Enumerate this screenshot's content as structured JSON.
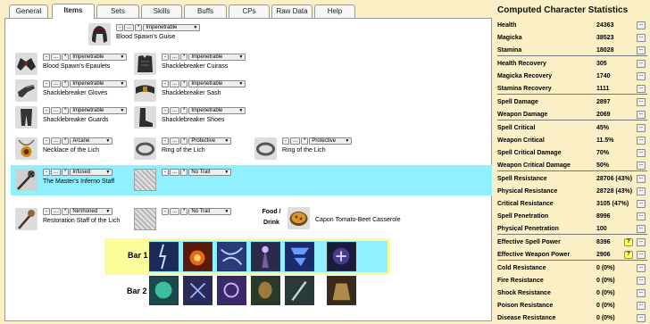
{
  "tabs": [
    "General",
    "Items",
    "Sets",
    "Skills",
    "Buffs",
    "CPs",
    "Raw Data",
    "Help"
  ],
  "active_tab": "Items",
  "ctrl": {
    "minus": "-",
    "dots": "...",
    "star": "*"
  },
  "items": {
    "head": {
      "name": "Blood Spawn's Guise",
      "trait": "Impenetrable"
    },
    "shoulders": {
      "name": "Blood Spawn's Epaulets",
      "trait": "Impenetrable"
    },
    "chest": {
      "name": "Shacklebreaker Cuirass",
      "trait": "Impenetrable"
    },
    "hands": {
      "name": "Shacklebreaker Gloves",
      "trait": "Impenetrable"
    },
    "waist": {
      "name": "Shacklebreaker Sash",
      "trait": "Impenetrable"
    },
    "legs": {
      "name": "Shacklebreaker Guards",
      "trait": "Impenetrable"
    },
    "feet": {
      "name": "Shacklebreaker Shoes",
      "trait": "Impenetrable"
    },
    "neck": {
      "name": "Necklace of the Lich",
      "trait": "Arcane"
    },
    "ring1": {
      "name": "Ring of the Lich",
      "trait": "Protective"
    },
    "ring2": {
      "name": "Ring of the Lich",
      "trait": "Protective"
    },
    "main1": {
      "name": "The Master's Inferno Staff",
      "trait": "Infused"
    },
    "off1": {
      "name": "",
      "trait": "No Trait"
    },
    "main2": {
      "name": "Restoration Staff of the Lich",
      "trait": "Nirnhoned"
    },
    "off2": {
      "name": "",
      "trait": "No Trait"
    }
  },
  "food": {
    "label_1": "Food /",
    "label_2": "Drink",
    "name": "Capon Tomato-Beet Casserole"
  },
  "bars": {
    "bar1": "Bar 1",
    "bar2": "Bar 2"
  },
  "stats_title": "Computed Character Statistics",
  "stats": [
    {
      "name": "Health",
      "value": "24363"
    },
    {
      "name": "Magicka",
      "value": "38523"
    },
    {
      "name": "Stamina",
      "value": "18028"
    },
    {
      "name": "Health Recovery",
      "value": "305"
    },
    {
      "name": "Magicka Recovery",
      "value": "1740"
    },
    {
      "name": "Stamina Recovery",
      "value": "1111"
    },
    {
      "name": "Spell Damage",
      "value": "2897"
    },
    {
      "name": "Weapon Damage",
      "value": "2069"
    },
    {
      "name": "Spell Critical",
      "value": "45%"
    },
    {
      "name": "Weapon Critical",
      "value": "11.5%"
    },
    {
      "name": "Spell Critical Damage",
      "value": "70%"
    },
    {
      "name": "Weapon Critical Damage",
      "value": "50%"
    },
    {
      "name": "Spell Resistance",
      "value": "28706 (43%)"
    },
    {
      "name": "Physical Resistance",
      "value": "28728 (43%)"
    },
    {
      "name": "Critical Resistance",
      "value": "3105 (47%)"
    },
    {
      "name": "Spell Penetration",
      "value": "8996"
    },
    {
      "name": "Physical Penetration",
      "value": "100"
    },
    {
      "name": "Effective Spell Power",
      "value": "8396",
      "help": "?"
    },
    {
      "name": "Effective Weapon Power",
      "value": "2906",
      "help": "?"
    },
    {
      "name": "Cold Resistance",
      "value": "0 (0%)"
    },
    {
      "name": "Fire Resistance",
      "value": "0 (0%)"
    },
    {
      "name": "Shock Resistance",
      "value": "0 (0%)"
    },
    {
      "name": "Poison Resistance",
      "value": "0 (0%)"
    },
    {
      "name": "Disease Resistance",
      "value": "0 (0%)"
    }
  ],
  "stat_button": "...",
  "colors": {
    "bg": "#fbefc6",
    "highlight": "#8ff0ff",
    "bar_box": "#fcfc9b",
    "help_button": "#ffff66"
  }
}
